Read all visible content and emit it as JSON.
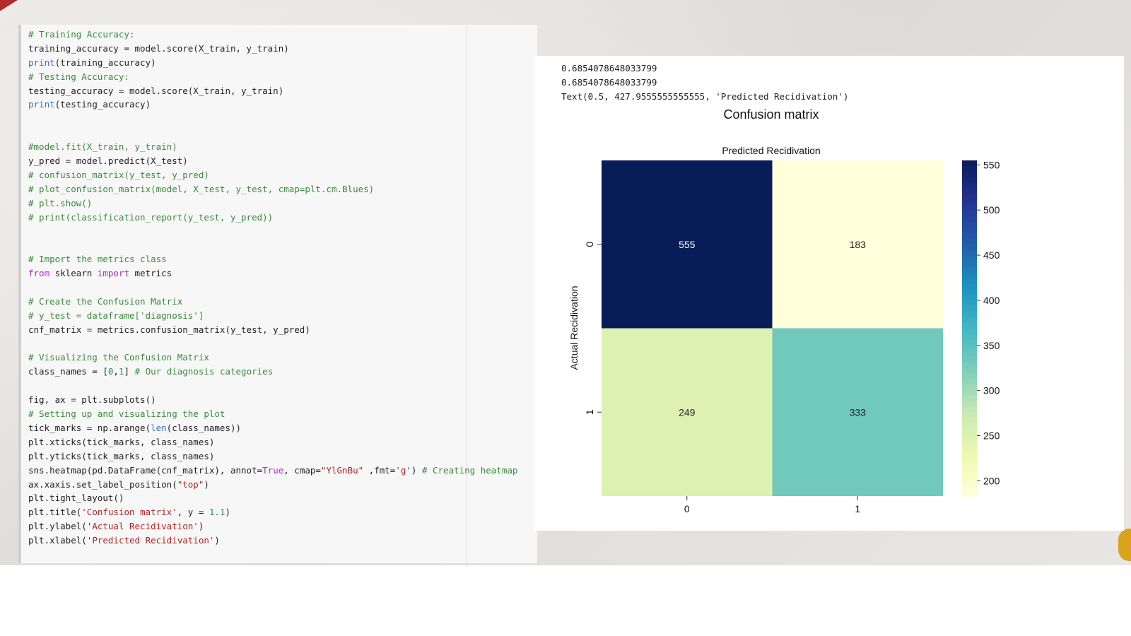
{
  "code_lines": [
    [
      [
        "c",
        "# Training Accuracy:"
      ]
    ],
    [
      [
        "t",
        "training_accuracy = model.score(X_train, y_train)"
      ]
    ],
    [
      [
        "b",
        "print"
      ],
      [
        "t",
        "(training_accuracy)"
      ]
    ],
    [
      [
        "c",
        "# Testing Accuracy:"
      ]
    ],
    [
      [
        "t",
        "testing_accuracy = model.score(X_train, y_train)"
      ]
    ],
    [
      [
        "b",
        "print"
      ],
      [
        "t",
        "(testing_accuracy)"
      ]
    ],
    [],
    [],
    [
      [
        "c",
        "#model.fit(X_train, y_train)"
      ]
    ],
    [
      [
        "t",
        "y_pred = model.predict(X_test)"
      ]
    ],
    [
      [
        "c",
        "# confusion_matrix(y_test, y_pred)"
      ]
    ],
    [
      [
        "c",
        "# plot_confusion_matrix(model, X_test, y_test, cmap=plt.cm.Blues)"
      ]
    ],
    [
      [
        "c",
        "# plt.show()"
      ]
    ],
    [
      [
        "c",
        "# print(classification_report(y_test, y_pred))"
      ]
    ],
    [],
    [],
    [
      [
        "c",
        "# Import the metrics class"
      ]
    ],
    [
      [
        "k",
        "from"
      ],
      [
        "t",
        " sklearn "
      ],
      [
        "k",
        "import"
      ],
      [
        "t",
        " metrics"
      ]
    ],
    [],
    [
      [
        "c",
        "# Create the Confusion Matrix"
      ]
    ],
    [
      [
        "c",
        "# y_test = dataframe['diagnosis']"
      ]
    ],
    [
      [
        "t",
        "cnf_matrix = metrics.confusion_matrix(y_test, y_pred)"
      ]
    ],
    [],
    [
      [
        "c",
        "# Visualizing the Confusion Matrix"
      ]
    ],
    [
      [
        "t",
        "class_names = ["
      ],
      [
        "n",
        "0"
      ],
      [
        "t",
        ","
      ],
      [
        "n",
        "1"
      ],
      [
        "t",
        "] "
      ],
      [
        "c",
        "# Our diagnosis categories"
      ]
    ],
    [],
    [
      [
        "t",
        "fig, ax = plt.subplots()"
      ]
    ],
    [
      [
        "c",
        "# Setting up and visualizing the plot"
      ]
    ],
    [
      [
        "t",
        "tick_marks = np.arange("
      ],
      [
        "b",
        "len"
      ],
      [
        "t",
        "(class_names))"
      ]
    ],
    [
      [
        "t",
        "plt.xticks(tick_marks, class_names)"
      ]
    ],
    [
      [
        "t",
        "plt.yticks(tick_marks, class_names)"
      ]
    ],
    [
      [
        "t",
        "sns.heatmap(pd.DataFrame(cnf_matrix), annot="
      ],
      [
        "k",
        "True"
      ],
      [
        "t",
        ", cmap="
      ],
      [
        "s",
        "\"YlGnBu\""
      ],
      [
        "t",
        " ,fmt="
      ],
      [
        "s",
        "'g'"
      ],
      [
        "t",
        ") "
      ],
      [
        "c",
        "# Creating heatmap"
      ]
    ],
    [
      [
        "t",
        "ax.xaxis.set_label_position("
      ],
      [
        "s",
        "\"top\""
      ],
      [
        "t",
        ")"
      ]
    ],
    [
      [
        "t",
        "plt.tight_layout()"
      ]
    ],
    [
      [
        "t",
        "plt.title("
      ],
      [
        "s",
        "'Confusion matrix'"
      ],
      [
        "t",
        ", y = "
      ],
      [
        "n",
        "1.1"
      ],
      [
        "t",
        ")"
      ]
    ],
    [
      [
        "t",
        "plt.ylabel("
      ],
      [
        "s",
        "'Actual Recidivation'"
      ],
      [
        "t",
        ")"
      ]
    ],
    [
      [
        "t",
        "plt.xlabel("
      ],
      [
        "s",
        "'Predicted Recidivation'"
      ],
      [
        "t",
        ")"
      ]
    ]
  ],
  "output": {
    "lines": [
      "0.6854078648033799",
      "0.6854078648033799",
      "Text(0.5, 427.9555555555555, 'Predicted Recidivation')"
    ]
  },
  "chart_data": {
    "type": "heatmap",
    "title": "Confusion matrix",
    "xlabel": "Predicted Recidivation",
    "ylabel": "Actual Recidivation",
    "x_tick_labels": [
      "0",
      "1"
    ],
    "y_tick_labels": [
      "0",
      "1"
    ],
    "values": [
      [
        555,
        183
      ],
      [
        249,
        333
      ]
    ],
    "colormap": "YlGnBu",
    "colorbar": {
      "ticks": [
        200,
        250,
        300,
        350,
        400,
        450,
        500,
        550
      ],
      "range": [
        183,
        555
      ]
    },
    "xlabel_position": "top",
    "grid": false
  }
}
